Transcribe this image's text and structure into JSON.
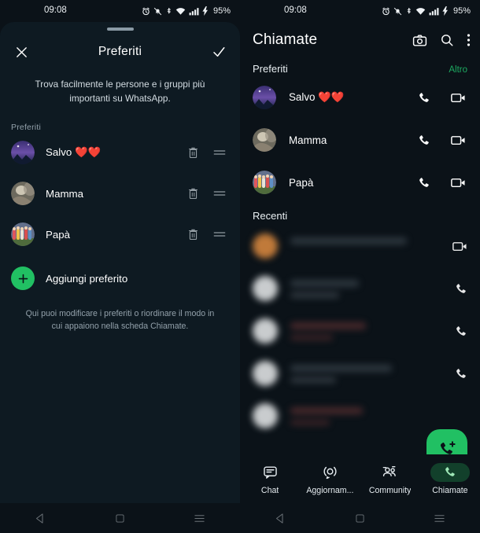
{
  "status_bar": {
    "time": "09:08",
    "battery": "95%",
    "icons": [
      "alarm-icon",
      "bell-muted-icon",
      "bluetooth-icon",
      "wifi-icon",
      "signal-bars-icon",
      "charging-bolt-icon"
    ]
  },
  "colors": {
    "background": "#0B1218",
    "sheet_background": "#0E1A22",
    "accent_green": "#21C063",
    "link_green": "#1DAA61",
    "active_tab_pill": "#12402B",
    "secondary_text": "#93a1ab"
  },
  "left_panel": {
    "sheet": {
      "close_icon": "close-icon",
      "title": "Preferiti",
      "confirm_icon": "check-icon",
      "description": "Trova facilmente le persone e i gruppi più importanti su WhatsApp.",
      "section_label": "Preferiti",
      "favorites": [
        {
          "name": "Salvo ❤️❤️",
          "avatar": "avatar-salvo",
          "delete_icon": "trash-icon",
          "reorder_icon": "drag-handle-icon"
        },
        {
          "name": "Mamma",
          "avatar": "avatar-mamma",
          "delete_icon": "trash-icon",
          "reorder_icon": "drag-handle-icon"
        },
        {
          "name": "Papà",
          "avatar": "avatar-papa",
          "delete_icon": "trash-icon",
          "reorder_icon": "drag-handle-icon"
        }
      ],
      "add_favorite_label": "Aggiungi preferito",
      "add_favorite_icon": "plus-icon",
      "footer_note": "Qui puoi modificare i preferiti o riordinare il modo in cui appaiono nella scheda Chiamate."
    }
  },
  "right_panel": {
    "header": {
      "title": "Chiamate",
      "actions": [
        "camera-icon",
        "search-icon",
        "overflow-menu-icon"
      ]
    },
    "favorites_section": {
      "label": "Preferiti",
      "more_label": "Altro",
      "items": [
        {
          "name": "Salvo ❤️❤️",
          "avatar": "avatar-salvo",
          "voice_icon": "phone-icon",
          "video_icon": "video-camera-icon"
        },
        {
          "name": "Mamma",
          "avatar": "avatar-mamma",
          "voice_icon": "phone-icon",
          "video_icon": "video-camera-icon"
        },
        {
          "name": "Papà",
          "avatar": "avatar-papa",
          "voice_icon": "phone-icon",
          "video_icon": "video-camera-icon"
        }
      ]
    },
    "recents_section": {
      "label": "Recenti",
      "items": [
        {
          "name": "",
          "subtitle": "",
          "icon": "video-camera-icon",
          "redacted": true
        },
        {
          "name": "",
          "subtitle": "",
          "icon": "phone-icon",
          "redacted": true
        },
        {
          "name": "",
          "subtitle": "",
          "icon": "phone-icon",
          "redacted": true
        },
        {
          "name": "",
          "subtitle": "",
          "icon": "phone-icon",
          "redacted": true
        },
        {
          "name": "",
          "subtitle": "",
          "icon": "phone-icon",
          "redacted": true
        }
      ]
    },
    "fab": {
      "icon": "new-call-icon",
      "label": ""
    },
    "tabs": [
      {
        "label": "Chat",
        "icon": "chat-icon",
        "active": false
      },
      {
        "label": "Aggiornam...",
        "icon": "updates-icon",
        "active": false
      },
      {
        "label": "Community",
        "icon": "community-icon",
        "active": false
      },
      {
        "label": "Chiamate",
        "icon": "phone-icon",
        "active": true
      }
    ]
  },
  "android_nav": {
    "back_icon": "back-triangle-icon",
    "home_icon": "home-square-icon",
    "recents_icon": "recents-icon"
  }
}
